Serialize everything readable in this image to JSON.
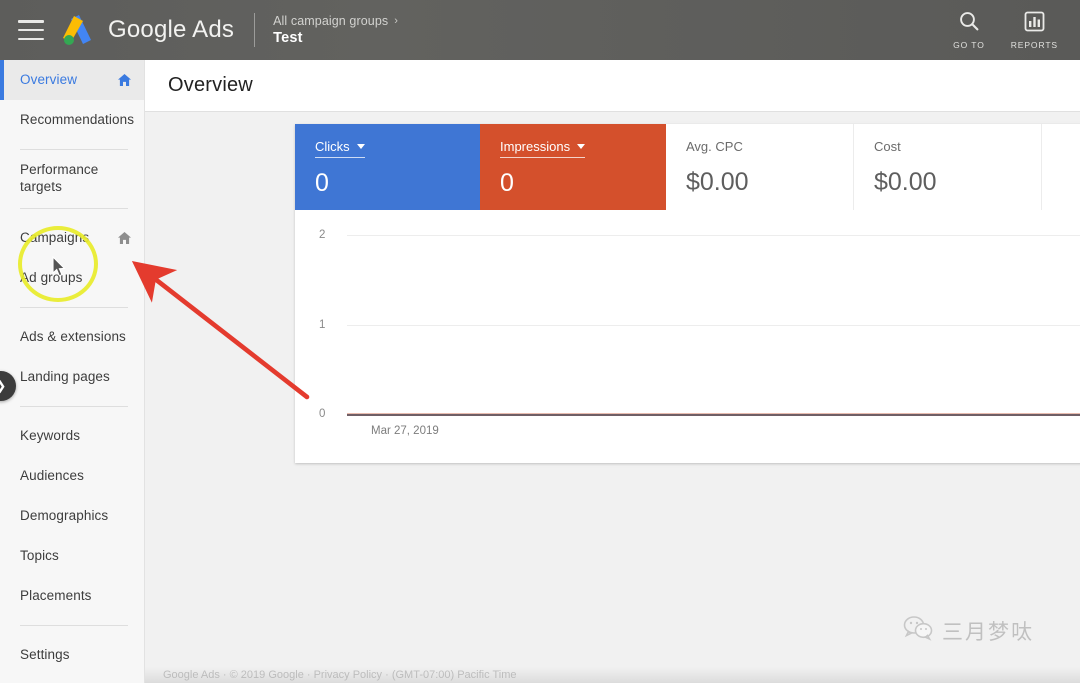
{
  "topbar": {
    "menu_icon": "hamburger-menu-icon",
    "logo_icon": "google-ads-logo-icon",
    "brand": "Google Ads",
    "breadcrumb_parent": "All campaign groups",
    "breadcrumb_arrow": "›",
    "breadcrumb_current": "Test",
    "actions": [
      {
        "icon": "search-icon",
        "label": "GO TO"
      },
      {
        "icon": "reports-bar-chart-icon",
        "label": "REPORTS"
      }
    ],
    "bg_color": "#5d5d5b"
  },
  "sidebar": {
    "collapse_handle_icon": "chevron-right-icon",
    "accent_color": "#3a7ae0",
    "items": [
      {
        "label": "Overview",
        "selected": true,
        "home_icon": true,
        "home_icon_color": "#3a7ae0"
      },
      {
        "label": "Recommendations",
        "selected": false,
        "home_icon": false
      },
      {
        "sep": true
      },
      {
        "label": "Performance targets",
        "selected": false,
        "home_icon": false
      },
      {
        "sep": true
      },
      {
        "label": "Campaigns",
        "selected": false,
        "home_icon": true,
        "home_icon_color": "#8e8e8e"
      },
      {
        "label": "Ad groups",
        "selected": false,
        "home_icon": false
      },
      {
        "sep": true
      },
      {
        "label": "Ads & extensions",
        "selected": false,
        "home_icon": false
      },
      {
        "label": "Landing pages",
        "selected": false,
        "home_icon": false
      },
      {
        "sep": true
      },
      {
        "label": "Keywords",
        "selected": false,
        "home_icon": false
      },
      {
        "label": "Audiences",
        "selected": false,
        "home_icon": false
      },
      {
        "label": "Demographics",
        "selected": false,
        "home_icon": false
      },
      {
        "label": "Topics",
        "selected": false,
        "home_icon": false
      },
      {
        "label": "Placements",
        "selected": false,
        "home_icon": false
      },
      {
        "sep": true
      },
      {
        "label": "Settings",
        "selected": false,
        "home_icon": false
      }
    ]
  },
  "page": {
    "title": "Overview"
  },
  "metrics": [
    {
      "label": "Clicks",
      "value": "0",
      "style": "clicks",
      "dropdown": true,
      "color": "#3f76d4"
    },
    {
      "label": "Impressions",
      "value": "0",
      "style": "impr",
      "dropdown": true,
      "color": "#d4502c"
    },
    {
      "label": "Avg. CPC",
      "value": "$0.00",
      "style": "plain",
      "dropdown": false
    },
    {
      "label": "Cost",
      "value": "$0.00",
      "style": "plain",
      "dropdown": false
    }
  ],
  "chart_data": {
    "type": "line",
    "title": "",
    "xlabel": "",
    "ylabel": "",
    "x": [
      "Mar 27, 2019"
    ],
    "yticks": [
      "2",
      "1",
      "0"
    ],
    "ylim": [
      0,
      2
    ],
    "grid": true,
    "legend": "none",
    "series": [
      {
        "name": "Clicks",
        "values": [
          0
        ],
        "color": "#3f76d4"
      },
      {
        "name": "Impressions",
        "values": [
          0
        ],
        "color": "#d4502c"
      }
    ]
  },
  "footer": {
    "text": "Google Ads   ·   © 2019 Google   ·   Privacy Policy   ·   (GMT-07:00) Pacific Time"
  },
  "annotations": {
    "highlight_circle": "campaigns-highlight-circle",
    "arrow": "red-arrow-pointing-to-home-icon",
    "cursor": "mouse-cursor"
  },
  "watermark": {
    "icon": "wechat-icon",
    "text": "三月梦呔"
  }
}
